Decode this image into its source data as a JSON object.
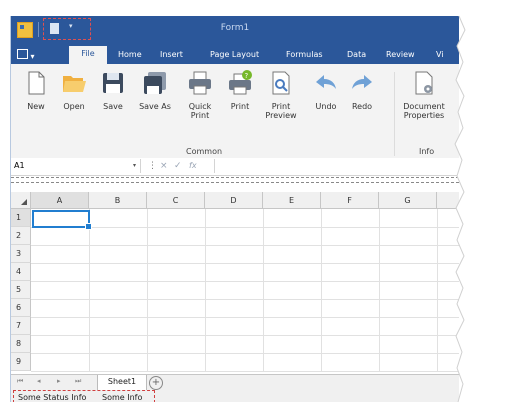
{
  "window": {
    "title": "Form1"
  },
  "quick_access": {
    "icons": [
      "save-icon",
      "customize-dropdown-icon"
    ]
  },
  "ribbon": {
    "backstage": {
      "label": "File-menu",
      "arrow": "▾"
    },
    "tabs": [
      {
        "label": "File",
        "active": true
      },
      {
        "label": "Home",
        "active": false
      },
      {
        "label": "Insert",
        "active": false
      },
      {
        "label": "Page Layout",
        "active": false
      },
      {
        "label": "Formulas",
        "active": false
      },
      {
        "label": "Data",
        "active": false
      },
      {
        "label": "Review",
        "active": false
      },
      {
        "label": "Vi",
        "active": false
      }
    ],
    "buttons": [
      {
        "line1": "New",
        "line2": "",
        "icon": "new-document-icon"
      },
      {
        "line1": "Open",
        "line2": "",
        "icon": "open-folder-icon"
      },
      {
        "line1": "Save",
        "line2": "",
        "icon": "save-icon"
      },
      {
        "line1": "Save As",
        "line2": "",
        "icon": "save-as-icon"
      },
      {
        "line1": "Quick",
        "line2": "Print",
        "icon": "quick-print-icon"
      },
      {
        "line1": "Print",
        "line2": "",
        "icon": "print-icon"
      },
      {
        "line1": "Print",
        "line2": "Preview",
        "icon": "print-preview-icon"
      },
      {
        "line1": "Undo",
        "line2": "",
        "icon": "undo-icon"
      },
      {
        "line1": "Redo",
        "line2": "",
        "icon": "redo-icon"
      },
      {
        "line1": "Document",
        "line2": "Properties",
        "icon": "document-properties-icon"
      }
    ],
    "groups": [
      {
        "label": "Common"
      },
      {
        "label": "Info"
      }
    ]
  },
  "formula_bar": {
    "cell_ref": "A1",
    "dropdown": "▾",
    "cancel": "×",
    "enter": "✓",
    "function": "fx",
    "value": ""
  },
  "sheet": {
    "columns": [
      "A",
      "B",
      "C",
      "D",
      "E",
      "F",
      "G"
    ],
    "rows": [
      "1",
      "2",
      "3",
      "4",
      "5",
      "6",
      "7",
      "8",
      "9"
    ],
    "selected_cell": "A1"
  },
  "sheet_tabs": {
    "nav": [
      "⏮",
      "◂",
      "▸",
      "⏭"
    ],
    "tabs": [
      "Sheet1"
    ],
    "add": "+"
  },
  "status_bar": {
    "items": [
      "Some Status Info",
      "Some Info"
    ]
  }
}
